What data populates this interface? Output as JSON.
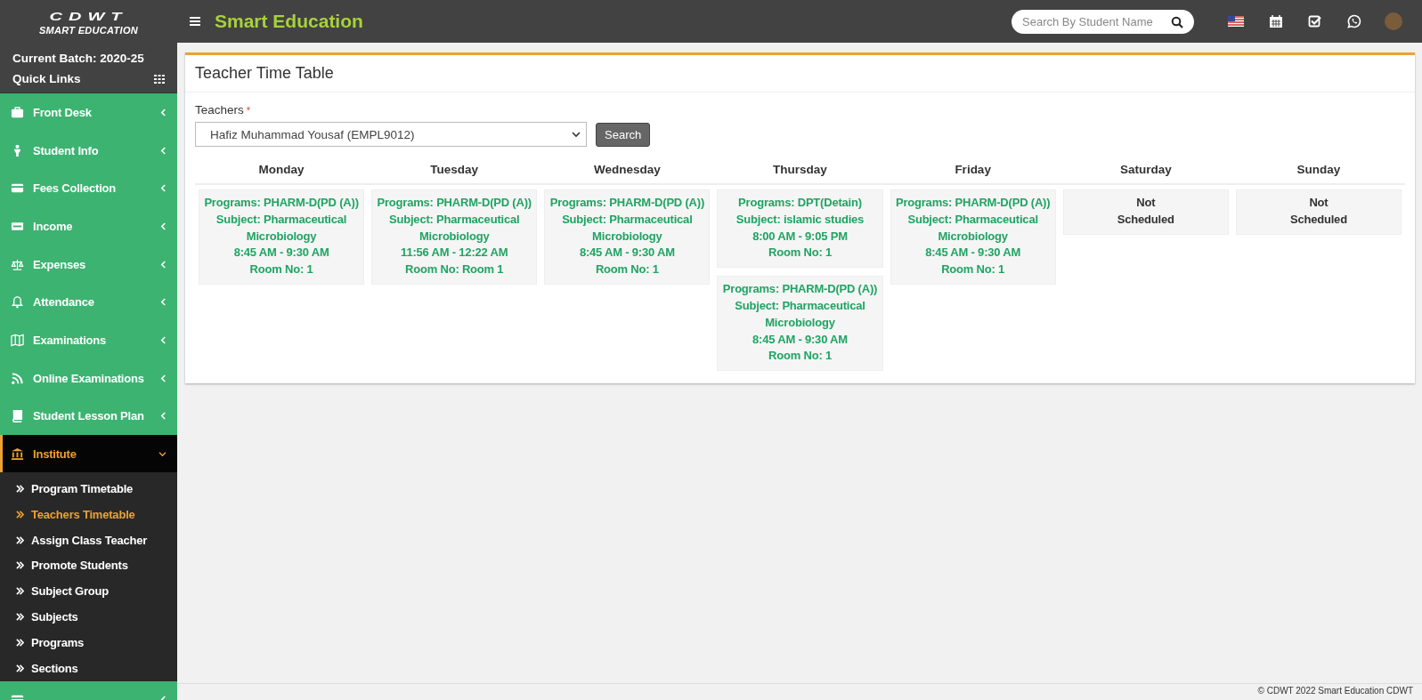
{
  "header": {
    "logo_top": "CDWT",
    "logo_bottom": "SMART EDUCATION",
    "title": "Smart Education",
    "search": {
      "placeholder": "Search By Student Name"
    }
  },
  "sidebar": {
    "batch": "Current Batch: 2020-25",
    "quick_links": "Quick Links",
    "items": [
      {
        "label": "Front Desk",
        "expanded": false,
        "selected": false
      },
      {
        "label": "Student Info",
        "expanded": false,
        "selected": false
      },
      {
        "label": "Fees Collection",
        "expanded": false,
        "selected": false
      },
      {
        "label": "Income",
        "expanded": false,
        "selected": false
      },
      {
        "label": "Expenses",
        "expanded": false,
        "selected": false
      },
      {
        "label": "Attendance",
        "expanded": false,
        "selected": false
      },
      {
        "label": "Examinations",
        "expanded": false,
        "selected": false
      },
      {
        "label": "Online Examinations",
        "expanded": false,
        "selected": false
      },
      {
        "label": "Student Lesson Plan",
        "expanded": false,
        "selected": false
      },
      {
        "label": "Institute",
        "expanded": true,
        "selected": true,
        "children": [
          {
            "label": "Program Timetable",
            "selected": false
          },
          {
            "label": "Teachers Timetable",
            "selected": true
          },
          {
            "label": "Assign Class Teacher",
            "selected": false
          },
          {
            "label": "Promote Students",
            "selected": false
          },
          {
            "label": "Subject Group",
            "selected": false
          },
          {
            "label": "Subjects",
            "selected": false
          },
          {
            "label": "Programs",
            "selected": false
          },
          {
            "label": "Sections",
            "selected": false
          }
        ]
      },
      {
        "expanded": false,
        "selected": false
      }
    ]
  },
  "panel": {
    "title": "Teacher Time Table",
    "teacher_label": "Teachers",
    "required_mark": "*",
    "teacher_value": "Hafiz Muhammad Yousaf (EMPL9012)",
    "search_button": "Search",
    "days": [
      {
        "day": "Monday",
        "entries": [
          {
            "kind": "class",
            "lines": [
              "Programs: PHARM-D(PD (A))",
              "Subject: Pharmaceutical Microbiology",
              "8:45 AM - 9:30 AM",
              "Room No: 1"
            ]
          }
        ]
      },
      {
        "day": "Tuesday",
        "entries": [
          {
            "kind": "class",
            "lines": [
              "Programs: PHARM-D(PD (A))",
              "Subject: Pharmaceutical Microbiology",
              "11:56 AM - 12:22 AM",
              "Room No: Room 1"
            ]
          }
        ]
      },
      {
        "day": "Wednesday",
        "entries": [
          {
            "kind": "class",
            "lines": [
              "Programs: PHARM-D(PD (A))",
              "Subject: Pharmaceutical Microbiology",
              "8:45 AM - 9:30 AM",
              "Room No: 1"
            ]
          }
        ]
      },
      {
        "day": "Thursday",
        "entries": [
          {
            "kind": "class",
            "lines": [
              "Programs: DPT(Detain)",
              "Subject: islamic studies",
              "8:00 AM - 9:05 PM",
              "Room No: 1"
            ]
          },
          {
            "kind": "class",
            "lines": [
              "Programs: PHARM-D(PD (A))",
              "Subject: Pharmaceutical Microbiology",
              "8:45 AM - 9:30 AM",
              "Room No: 1"
            ]
          }
        ]
      },
      {
        "day": "Friday",
        "entries": [
          {
            "kind": "class",
            "lines": [
              "Programs: PHARM-D(PD (A))",
              "Subject: Pharmaceutical Microbiology",
              "8:45 AM - 9:30 AM",
              "Room No: 1"
            ]
          }
        ]
      },
      {
        "day": "Saturday",
        "entries": [
          {
            "kind": "none",
            "lines": [
              "Not",
              "Scheduled"
            ]
          }
        ]
      },
      {
        "day": "Sunday",
        "entries": [
          {
            "kind": "none",
            "lines": [
              "Not",
              "Scheduled"
            ]
          }
        ]
      }
    ]
  },
  "footer": "© CDWT 2022 Smart Education CDWT"
}
